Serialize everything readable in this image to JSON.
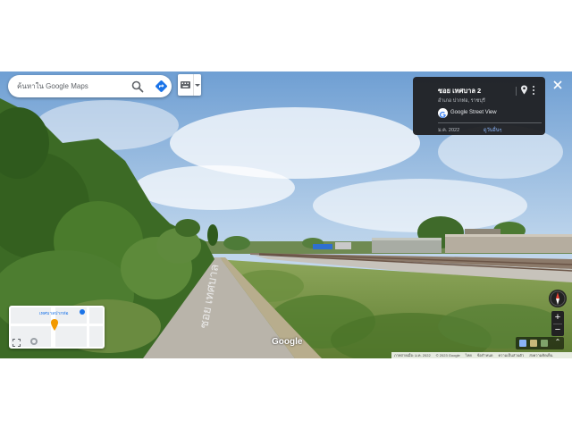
{
  "search": {
    "placeholder": "ค้นหาใน Google Maps"
  },
  "icons": {
    "search": "search-icon",
    "directions": "directions-icon",
    "keyboard": "keyboard-icon",
    "dropdown": "caret-down-icon",
    "pin": "map-pin-icon",
    "more": "more-vert-icon",
    "close": "close-icon",
    "compass": "compass-icon",
    "expand": "expand-icon"
  },
  "info_card": {
    "title": "ซอย เทศบาล 2",
    "subtitle": "อำเภอ ปากท่อ, ราชบุรี",
    "source": "Google Street View",
    "date": "ม.ค. 2022",
    "see_more": "ดูวันอื่นๆ"
  },
  "minimap": {
    "poi_label": "เทศบาลปากท่อ"
  },
  "street_label": "ซอย เทศบาล",
  "branding": {
    "logo": "Google"
  },
  "zoom": {
    "in": "+",
    "out": "−"
  },
  "thumbnails": {
    "toggle": "⌃"
  },
  "footer": {
    "capture": "ภาพถ่ายเมื่อ: ม.ค. 2022",
    "copyright": "© 2023 Google",
    "links": [
      "ไทย",
      "ข้อกำหนด",
      "ความเป็นส่วนตัว",
      "ส่งความคิดเห็น"
    ]
  },
  "colors": {
    "accent": "#1a73e8",
    "card_bg": "#202124",
    "card_link": "#8ab4f8",
    "sky": "#9ec3e6",
    "vegetation": "#4f7a2c",
    "road": "#b9b4aa"
  }
}
